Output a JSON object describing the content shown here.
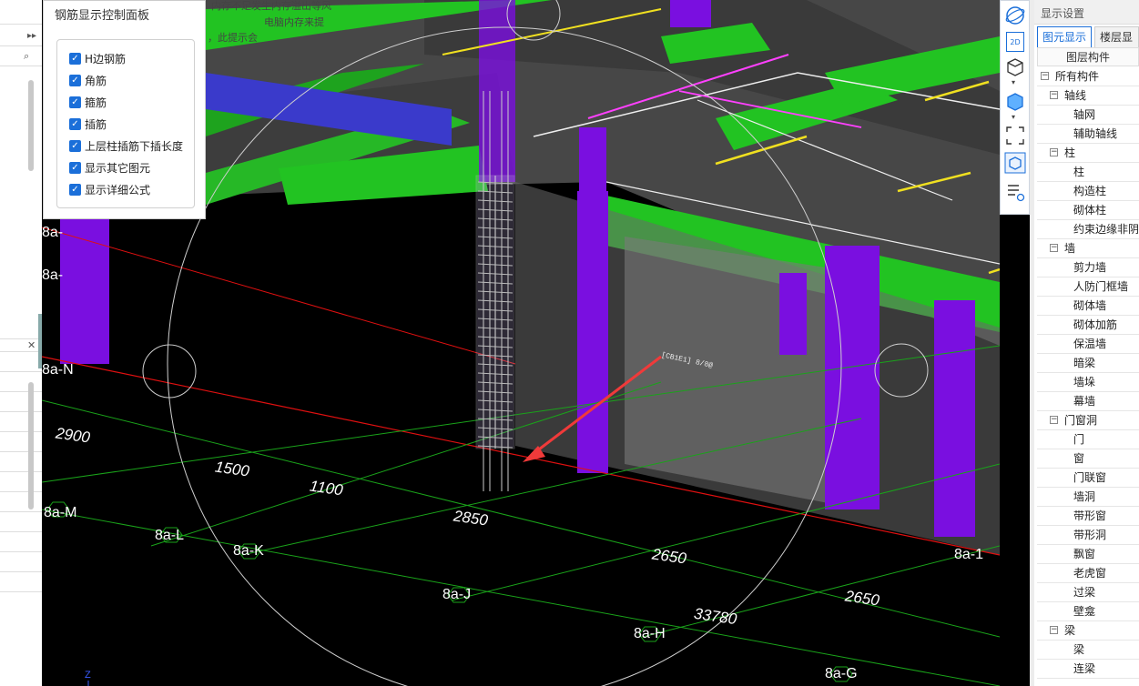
{
  "rebar_panel": {
    "title": "钢筋显示控制面板",
    "options": [
      {
        "label": "H边钢筋",
        "checked": true
      },
      {
        "label": "角筋",
        "checked": true
      },
      {
        "label": "箍筋",
        "checked": true
      },
      {
        "label": "插筋",
        "checked": true
      },
      {
        "label": "上层柱插筋下插长度",
        "checked": true
      },
      {
        "label": "显示其它图元",
        "checked": true
      },
      {
        "label": "显示详细公式",
        "checked": true
      }
    ],
    "warning_fragments": [
      "内存不足发生内存溢出等风",
      "电脑内存来提",
      "，此提示会"
    ]
  },
  "viewport": {
    "axis_labels": [
      "8a-N",
      "8a-M",
      "8a-L",
      "8a-K",
      "8a-J",
      "8a-H",
      "8a-G",
      "8a-1",
      "8a-",
      "8a-"
    ],
    "dimensions": [
      "2900",
      "1500",
      "1100",
      "2850",
      "2650",
      "2650",
      "33780"
    ],
    "rebar_tag": "[CB1E1] 8/8@",
    "colors": {
      "beam_green": "#22c322",
      "column_purple": "#7a0fe0",
      "slab_gray": "#4a4a4a",
      "wall_blue": "#3a3acb",
      "grid_red": "#e01010",
      "grid_green": "#1aa31a",
      "rebar_yellow": "#f0e020",
      "rebar_pink": "#ff40ff",
      "arrow_red": "#f03a3a"
    }
  },
  "view_toolbar": {
    "buttons": [
      {
        "icon": "orbit-icon"
      },
      {
        "icon": "2d-view-icon",
        "text": "2D"
      },
      {
        "icon": "3d-box-icon"
      },
      {
        "icon": "solid-box-icon"
      },
      {
        "icon": "fit-view-icon"
      },
      {
        "icon": "isometric-view-icon"
      },
      {
        "icon": "properties-view-icon"
      }
    ]
  },
  "right_panel": {
    "title": "显示设置",
    "tabs": [
      "图元显示",
      "楼层显示"
    ],
    "active_tab": 0,
    "tree_header": "图层构件",
    "tree": [
      {
        "label": "所有构件",
        "level": 0,
        "toggle": "−"
      },
      {
        "label": "轴线",
        "level": 1,
        "toggle": "−"
      },
      {
        "label": "轴网",
        "level": 2
      },
      {
        "label": "辅助轴线",
        "level": 2
      },
      {
        "label": "柱",
        "level": 1,
        "toggle": "−"
      },
      {
        "label": "柱",
        "level": 2
      },
      {
        "label": "构造柱",
        "level": 2
      },
      {
        "label": "砌体柱",
        "level": 2
      },
      {
        "label": "约束边缘非阴",
        "level": 2
      },
      {
        "label": "墙",
        "level": 1,
        "toggle": "−"
      },
      {
        "label": "剪力墙",
        "level": 2
      },
      {
        "label": "人防门框墙",
        "level": 2
      },
      {
        "label": "砌体墙",
        "level": 2
      },
      {
        "label": "砌体加筋",
        "level": 2
      },
      {
        "label": "保温墙",
        "level": 2
      },
      {
        "label": "暗梁",
        "level": 2
      },
      {
        "label": "墙垛",
        "level": 2
      },
      {
        "label": "幕墙",
        "level": 2
      },
      {
        "label": "门窗洞",
        "level": 1,
        "toggle": "−"
      },
      {
        "label": "门",
        "level": 2
      },
      {
        "label": "窗",
        "level": 2
      },
      {
        "label": "门联窗",
        "level": 2
      },
      {
        "label": "墙洞",
        "level": 2
      },
      {
        "label": "带形窗",
        "level": 2
      },
      {
        "label": "带形洞",
        "level": 2
      },
      {
        "label": "飘窗",
        "level": 2
      },
      {
        "label": "老虎窗",
        "level": 2
      },
      {
        "label": "过梁",
        "level": 2
      },
      {
        "label": "壁龛",
        "level": 2
      },
      {
        "label": "梁",
        "level": 1,
        "toggle": "−"
      },
      {
        "label": "梁",
        "level": 2
      },
      {
        "label": "连梁",
        "level": 2
      }
    ]
  }
}
